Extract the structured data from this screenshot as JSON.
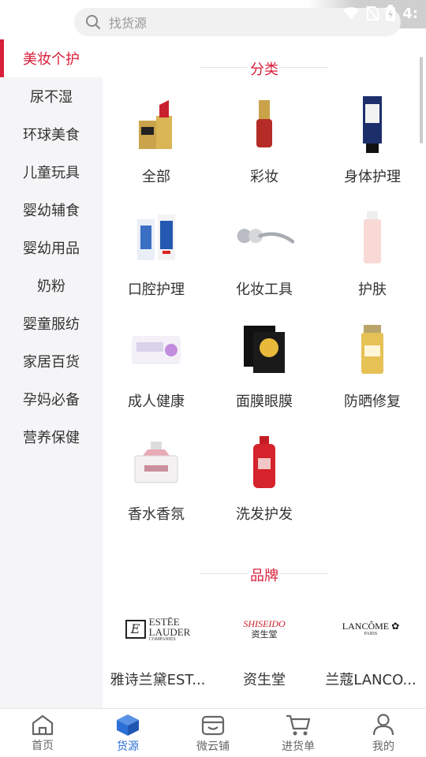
{
  "search": {
    "placeholder": "找货源"
  },
  "status": {
    "time": "4:"
  },
  "sidebar": {
    "items": [
      {
        "label": "美妆个护",
        "active": true
      },
      {
        "label": "尿不湿"
      },
      {
        "label": "环球美食"
      },
      {
        "label": "儿童玩具"
      },
      {
        "label": "婴幼辅食"
      },
      {
        "label": "婴幼用品"
      },
      {
        "label": "奶粉"
      },
      {
        "label": "婴童服纺"
      },
      {
        "label": "家居百货"
      },
      {
        "label": "孕妈必备"
      },
      {
        "label": "营养保健"
      }
    ]
  },
  "category": {
    "title": "分类",
    "items": [
      {
        "label": "全部",
        "icon": "lipstick-icon"
      },
      {
        "label": "彩妆",
        "icon": "nail-polish-icon"
      },
      {
        "label": "身体护理",
        "icon": "lotion-tube-icon"
      },
      {
        "label": "口腔护理",
        "icon": "toothpaste-icon"
      },
      {
        "label": "化妆工具",
        "icon": "face-roller-icon"
      },
      {
        "label": "护肤",
        "icon": "skincare-bottle-icon"
      },
      {
        "label": "成人健康",
        "icon": "pad-pack-icon"
      },
      {
        "label": "面膜眼膜",
        "icon": "face-mask-icon"
      },
      {
        "label": "防晒修复",
        "icon": "sunscreen-icon"
      },
      {
        "label": "香水香氛",
        "icon": "perfume-icon"
      },
      {
        "label": "洗发护发",
        "icon": "shampoo-icon"
      }
    ]
  },
  "brand": {
    "title": "品牌",
    "items": [
      {
        "label": "雅诗兰黛EST...",
        "logo_line1": "ESTĒE",
        "logo_line2": "LAUDER",
        "logo_line3": "COMPANIES"
      },
      {
        "label": "资生堂",
        "logo_line1": "SHISEIDO",
        "logo_line2": "资生堂"
      },
      {
        "label": "兰蔻LANCO...",
        "logo_line1": "LANCÔME",
        "logo_line2": "PARIS"
      }
    ]
  },
  "tabbar": {
    "items": [
      {
        "label": "首页",
        "icon": "home-icon"
      },
      {
        "label": "货源",
        "icon": "cube-icon",
        "active": true
      },
      {
        "label": "微云铺",
        "icon": "shop-icon"
      },
      {
        "label": "进货单",
        "icon": "cart-icon"
      },
      {
        "label": "我的",
        "icon": "user-icon"
      }
    ]
  },
  "colors": {
    "accent": "#d81e3a",
    "tab_active": "#2c6fd6"
  }
}
